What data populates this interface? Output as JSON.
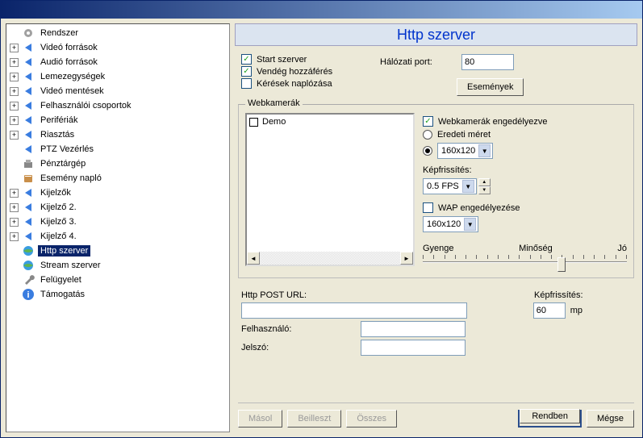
{
  "header": {
    "title": "Http szerver"
  },
  "tree": {
    "items": [
      {
        "label": "Rendszer",
        "icon": "gear",
        "expander": "",
        "level": 0
      },
      {
        "label": "Videó források",
        "icon": "arrow-blue",
        "expander": "+",
        "level": 0
      },
      {
        "label": "Audió források",
        "icon": "arrow-blue",
        "expander": "+",
        "level": 0
      },
      {
        "label": "Lemezegységek",
        "icon": "arrow-blue",
        "expander": "+",
        "level": 0
      },
      {
        "label": "Videó mentések",
        "icon": "arrow-blue",
        "expander": "+",
        "level": 0
      },
      {
        "label": "Felhasználói csoportok",
        "icon": "arrow-blue",
        "expander": "+",
        "level": 0
      },
      {
        "label": "Perifériák",
        "icon": "arrow-blue",
        "expander": "+",
        "level": 0
      },
      {
        "label": "Riasztás",
        "icon": "arrow-blue",
        "expander": "+",
        "level": 0
      },
      {
        "label": "PTZ Vezérlés",
        "icon": "arrow-blue",
        "expander": "",
        "level": 0
      },
      {
        "label": "Pénztárgép",
        "icon": "cashreg",
        "expander": "",
        "level": 0
      },
      {
        "label": "Esemény napló",
        "icon": "book",
        "expander": "",
        "level": 0
      },
      {
        "label": "Kijelzők",
        "icon": "arrow-blue",
        "expander": "+",
        "level": 0
      },
      {
        "label": "Kijelző 2.",
        "icon": "arrow-blue",
        "expander": "+",
        "level": 0
      },
      {
        "label": "Kijelző 3.",
        "icon": "arrow-blue",
        "expander": "+",
        "level": 0
      },
      {
        "label": "Kijelző 4.",
        "icon": "arrow-blue",
        "expander": "+",
        "level": 0
      },
      {
        "label": "Http szerver",
        "icon": "globe",
        "expander": "",
        "level": 0,
        "selected": true
      },
      {
        "label": "Stream szerver",
        "icon": "globe",
        "expander": "",
        "level": 0
      },
      {
        "label": "Felügyelet",
        "icon": "wrench",
        "expander": "",
        "level": 0
      },
      {
        "label": "Támogatás",
        "icon": "info",
        "expander": "",
        "level": 0
      }
    ]
  },
  "options": {
    "start_server": {
      "label": "Start szerver",
      "checked": true
    },
    "guest_access": {
      "label": "Vendég hozzáférés",
      "checked": true
    },
    "log_requests": {
      "label": "Kérések naplózása",
      "checked": false
    },
    "network_port_label": "Hálózati port:",
    "network_port_value": "80",
    "events_button": "Események"
  },
  "webcams": {
    "group_title": "Webkamerák",
    "list": [
      {
        "label": "Demo",
        "checked": false
      }
    ],
    "enabled": {
      "label": "Webkamerák engedélyezve",
      "checked": true
    },
    "original_size": {
      "label": "Eredeti méret",
      "checked": false
    },
    "custom_size": {
      "checked": true,
      "value": "160x120"
    },
    "refresh_label": "Képfrissítés:",
    "refresh_value": "0.5 FPS",
    "wap_enabled": {
      "label": "WAP engedélyezése",
      "checked": false
    },
    "wap_size_value": "160x120",
    "quality": {
      "weak": "Gyenge",
      "label": "Minőség",
      "good": "Jó"
    }
  },
  "post": {
    "url_label": "Http POST URL:",
    "url_value": "",
    "refresh_label": "Képfrissítés:",
    "refresh_value": "60",
    "refresh_unit": "mp",
    "user_label": "Felhasználó:",
    "user_value": "",
    "pass_label": "Jelszó:",
    "pass_value": ""
  },
  "buttons": {
    "copy": "Másol",
    "paste": "Beilleszt",
    "all": "Összes",
    "ok": "Rendben",
    "cancel": "Mégse"
  }
}
